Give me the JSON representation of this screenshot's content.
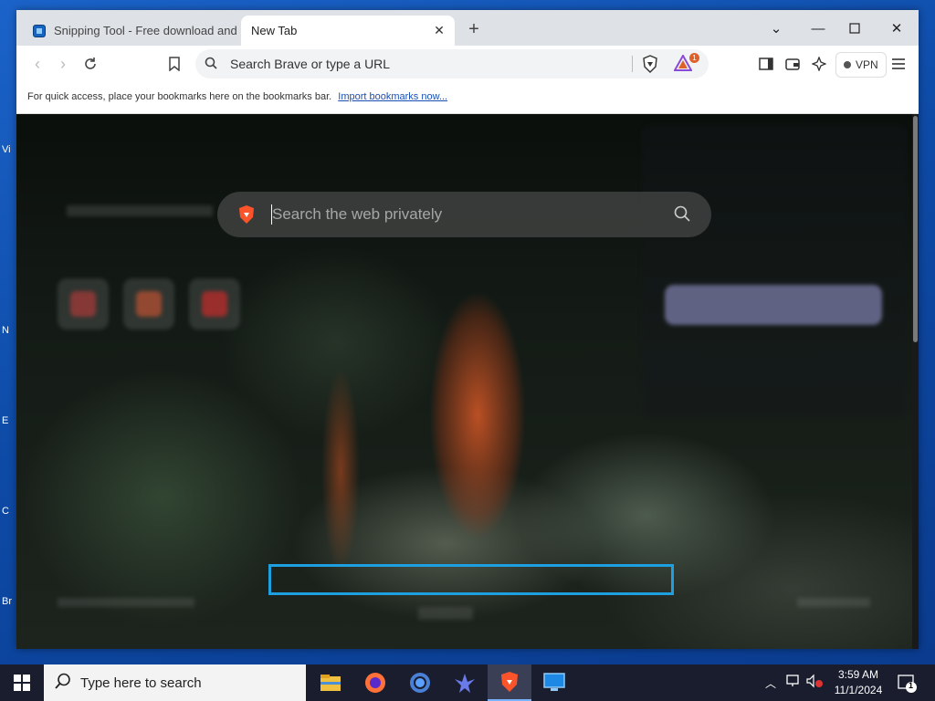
{
  "desktop": {
    "labels": [
      "Vi",
      "N",
      "E",
      "C",
      "Br"
    ]
  },
  "tabs": [
    {
      "title": "Snipping Tool - Free download and",
      "active": false
    },
    {
      "title": "New Tab",
      "active": true
    }
  ],
  "toolbar": {
    "url_placeholder": "Search Brave or type a URL",
    "rewards_badge": "1",
    "vpn_label": "VPN"
  },
  "bookmarks_bar": {
    "message": "For quick access, place your bookmarks here on the bookmarks bar.",
    "import_link": "Import bookmarks now..."
  },
  "ntp": {
    "search_placeholder": "Search the web privately"
  },
  "taskbar": {
    "search_placeholder": "Type here to search",
    "apps": [
      "file-explorer-icon",
      "firefox-icon",
      "chrome-icon",
      "bird-app-icon",
      "brave-icon",
      "remote-desktop-icon"
    ],
    "time": "3:59 AM",
    "date": "11/1/2024",
    "notification_count": "1"
  },
  "colors": {
    "desktop_bg": "#0d4aa6",
    "taskbar_bg": "#1a1d2e",
    "focus_outline": "#1ea0e0",
    "brave_orange": "#fb542b"
  }
}
